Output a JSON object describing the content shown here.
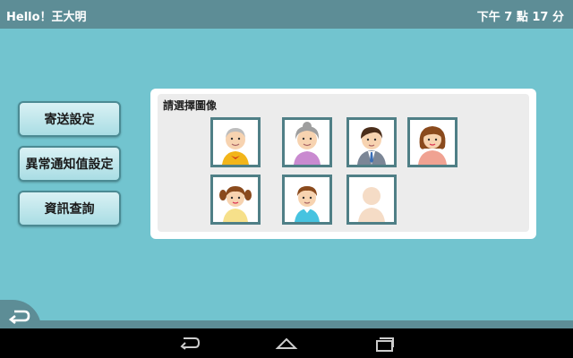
{
  "status_bar": {
    "greeting": "Hello！王大明",
    "time": "下午 7 點 17 分"
  },
  "menu": [
    {
      "label": "寄送設定"
    },
    {
      "label": "異常通知值設定"
    },
    {
      "label": "資訊查詢"
    }
  ],
  "panel": {
    "title": "請選擇圖像",
    "avatars": [
      {
        "name": "grandpa-avatar"
      },
      {
        "name": "grandma-avatar"
      },
      {
        "name": "father-avatar"
      },
      {
        "name": "mother-avatar"
      },
      {
        "name": "girl-avatar"
      },
      {
        "name": "boy-avatar"
      },
      {
        "name": "blank-avatar"
      }
    ]
  },
  "icons": {
    "back": "back-arrow-icon",
    "nav_back": "nav-back-icon",
    "nav_home": "nav-home-icon",
    "nav_recent": "nav-recent-apps-icon"
  },
  "colors": {
    "background": "#72c4cf",
    "bar": "#5d8d96",
    "frame": "#4f7f86"
  }
}
